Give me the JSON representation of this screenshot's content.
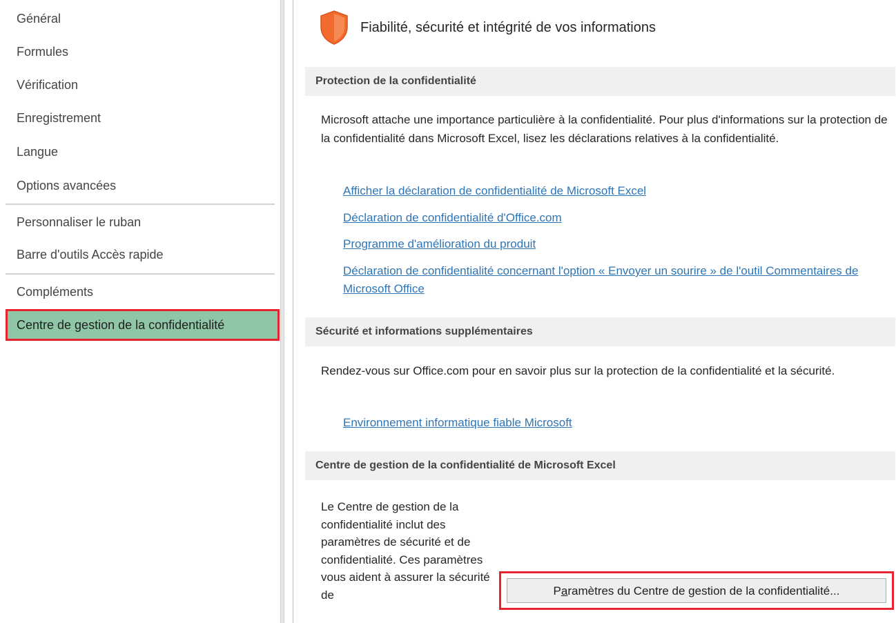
{
  "sidebar": {
    "items": [
      {
        "label": "Général"
      },
      {
        "label": "Formules"
      },
      {
        "label": "Vérification"
      },
      {
        "label": "Enregistrement"
      },
      {
        "label": "Langue"
      },
      {
        "label": "Options avancées"
      },
      {
        "label": "Personnaliser le ruban"
      },
      {
        "label": "Barre d'outils Accès rapide"
      },
      {
        "label": "Compléments"
      },
      {
        "label": "Centre de gestion de la confidentialité"
      }
    ],
    "selected_index": 9
  },
  "header": {
    "icon": "shield-icon",
    "title": "Fiabilité, sécurité et intégrité de vos informations"
  },
  "sections": {
    "privacy": {
      "heading": "Protection de la confidentialité",
      "text": "Microsoft attache une importance particulière à la confidentialité. Pour plus d'informations sur la protection de la confidentialité dans Microsoft Excel, lisez les déclarations relatives à la confidentialité.",
      "links": [
        "Afficher la déclaration de confidentialité de Microsoft Excel",
        "Déclaration de confidentialité d'Office.com",
        "Programme d'amélioration du produit",
        "Déclaration de confidentialité concernant l'option « Envoyer un sourire » de l'outil Commentaires de Microsoft Office"
      ]
    },
    "security": {
      "heading": "Sécurité et informations supplémentaires",
      "text": "Rendez-vous sur Office.com pour en savoir plus sur la protection de la confidentialité et la sécurité.",
      "links": [
        "Environnement informatique fiable Microsoft"
      ]
    },
    "trust_center": {
      "heading": "Centre de gestion de la confidentialité de Microsoft Excel",
      "text": "Le Centre de gestion de la confidentialité inclut des paramètres de sécurité et de confidentialité. Ces paramètres vous aident à assurer la sécurité de",
      "button_mnemonic": "a",
      "button_label_pre": "P",
      "button_label_post": "ramètres du Centre de gestion de la confidentialité..."
    }
  },
  "colors": {
    "selected_bg": "#8fc6a6",
    "highlight_border": "#e52430",
    "link": "#2e75b6",
    "shield": "#f26a2e"
  }
}
